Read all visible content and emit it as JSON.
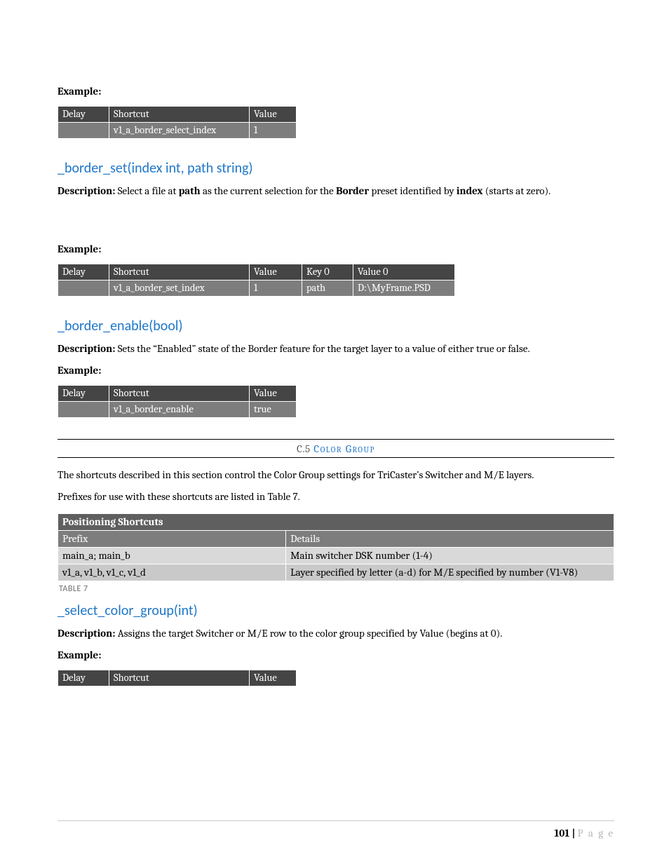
{
  "section1": {
    "example_label": "Example:",
    "table": {
      "h1": "Delay",
      "h2": "Shortcut",
      "h3": "Value",
      "r1c1": "",
      "r1c2": "v1_a_border_select_index",
      "r1c3": "1"
    }
  },
  "func1": {
    "heading": "_border_set(index int, path string)",
    "desc_label": "Description:",
    "desc_p1": " Select a file at ",
    "desc_bold1": "path",
    "desc_p2": " as the current selection for the ",
    "desc_bold2": "Border",
    "desc_p3": " preset identified by ",
    "desc_bold3": "index",
    "desc_p4": " (starts at zero).",
    "example_label": "Example:",
    "table": {
      "h1": "Delay",
      "h2": "Shortcut",
      "h3": "Value",
      "h4": "Key 0",
      "h5": "Value 0",
      "r1c1": "",
      "r1c2": "v1_a_border_set_index",
      "r1c3": "1",
      "r1c4": "path",
      "r1c5": "D:\\MyFrame.PSD"
    }
  },
  "func2": {
    "heading": "_border_enable(bool)",
    "desc_label": "Description:",
    "desc_text": " Sets the “Enabled” state of the Border feature for the target layer to a value of either true or false.",
    "example_label": "Example:",
    "table": {
      "h1": "Delay",
      "h2": "Shortcut",
      "h3": "Value",
      "r1c1": "",
      "r1c2": "v1_a_border_enable",
      "r1c3": "true"
    }
  },
  "section_header": {
    "num": "C.5",
    "title": " Color Group"
  },
  "color_group": {
    "para1": "The shortcuts described in this section control the Color Group settings for TriCaster’s Switcher and M/E layers.",
    "para2": "Prefixes for use with these shortcuts are listed in Table 7.",
    "table": {
      "title": "Positioning Shortcuts",
      "h1": "Prefix",
      "h2": "Details",
      "r1c1": "main_a; main_b",
      "r1c2": "Main switcher DSK number (1-4)",
      "r2c1": "v1_a, v1_b, v1_c, v1_d",
      "r2c2": "Layer specified by letter (a-d)  for M/E specified by number (V1-V8)"
    },
    "caption": "TABLE 7"
  },
  "func3": {
    "heading": "_select_color_group(int)",
    "desc_label": "Description:",
    "desc_text": " Assigns the target Switcher or M/E row to the color group specified by Value (begins at 0).",
    "example_label": "Example:",
    "table": {
      "h1": "Delay",
      "h2": "Shortcut",
      "h3": "Value"
    }
  },
  "footer": {
    "page_num": "101",
    "sep": " | ",
    "page_word": "P a g e"
  }
}
